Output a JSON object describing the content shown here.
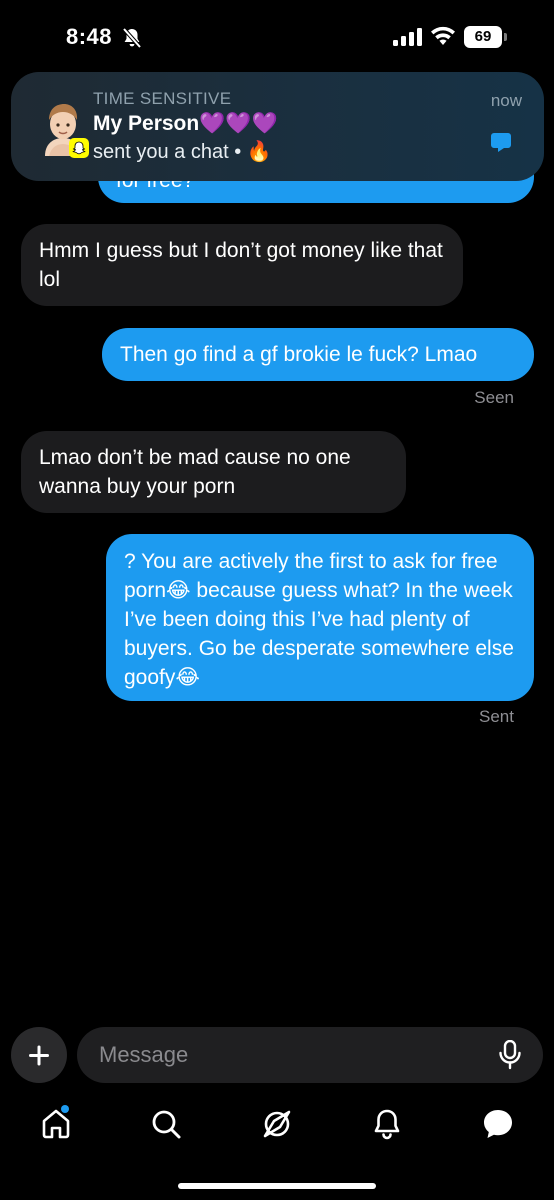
{
  "status_bar": {
    "time": "8:48",
    "battery": "69"
  },
  "notification": {
    "eyebrow": "TIME SENSITIVE",
    "title": "My Person💜💜💜",
    "body": "sent you a chat • 🔥",
    "time": "now"
  },
  "messages": [
    {
      "direction": "outgoing",
      "text": "for free?"
    },
    {
      "direction": "incoming",
      "text": "Hmm I guess but I don’t got money like that lol"
    },
    {
      "direction": "outgoing",
      "text": "Then go find a gf brokie le fuck? Lmao",
      "receipt": "Seen"
    },
    {
      "direction": "incoming",
      "text": "Lmao don’t be mad cause no one wanna buy your porn"
    },
    {
      "direction": "outgoing",
      "text": "? You are actively the first to ask for free porn😂 because guess what? In the week I’ve been doing this I’ve had plenty of buyers. Go be desperate somewhere else goofy😂",
      "receipt": "Sent"
    }
  ],
  "composer": {
    "placeholder": "Message"
  },
  "tabs": [
    {
      "label": "home",
      "icon": "home-icon",
      "badge": true
    },
    {
      "label": "search",
      "icon": "search-icon"
    },
    {
      "label": "explore",
      "icon": "compass-icon"
    },
    {
      "label": "notifications",
      "icon": "bell-icon"
    },
    {
      "label": "messages",
      "icon": "chat-bubble-icon",
      "active": true
    }
  ],
  "colors": {
    "outgoing_bubble": "#1d9bf0",
    "incoming_bubble": "#1c1c1e",
    "background": "#000000"
  }
}
